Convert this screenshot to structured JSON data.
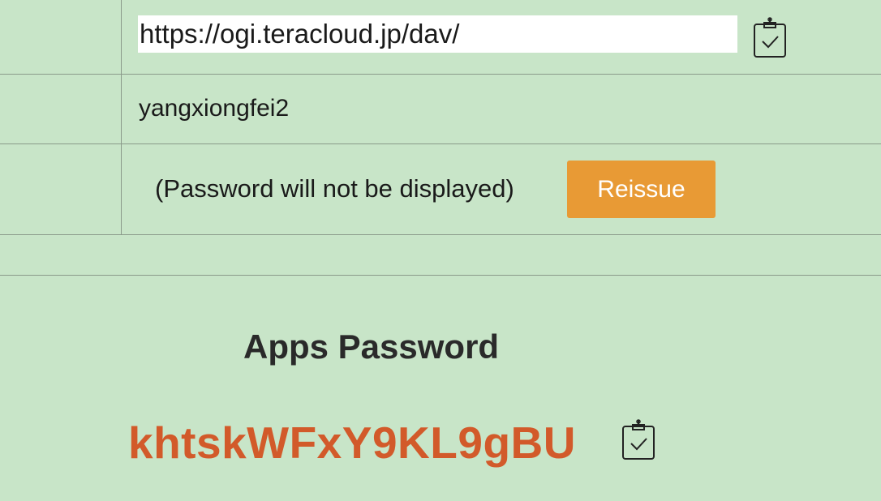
{
  "webdav": {
    "url_value": "https://ogi.teracloud.jp/dav/",
    "url_copy_icon": "clipboard-check-icon",
    "username": "yangxiongfei2",
    "password_note": "(Password will not be displayed)",
    "reissue_label": "Reissue"
  },
  "apps_password": {
    "title": "Apps Password",
    "value": "khtskWFxY9KL9gBU",
    "copy_icon": "clipboard-check-icon"
  },
  "colors": {
    "background": "#c8e5c8",
    "button": "#e89a35",
    "password_text": "#d25a2a"
  }
}
